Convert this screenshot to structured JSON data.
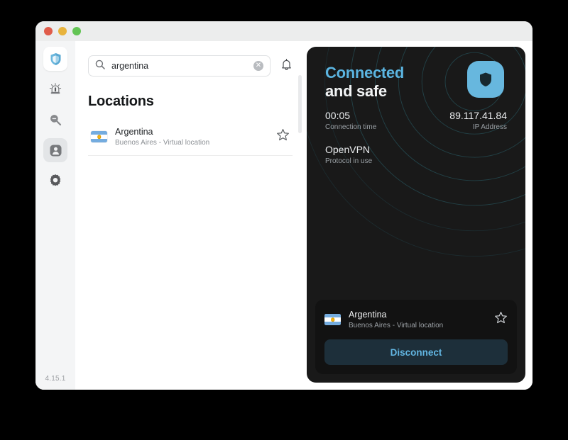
{
  "window": {
    "traffic_lights": [
      "close",
      "minimize",
      "maximize"
    ],
    "version": "4.15.1"
  },
  "sidebar": {
    "items": [
      {
        "icon": "shield-icon",
        "name": "vpn",
        "active": true
      },
      {
        "icon": "alarm-icon",
        "name": "threat",
        "active": false
      },
      {
        "icon": "search-scan-icon",
        "name": "scan",
        "active": false
      },
      {
        "icon": "account-icon",
        "name": "account",
        "active": false
      },
      {
        "icon": "gear-icon",
        "name": "settings",
        "active": false
      }
    ]
  },
  "search": {
    "value": "argentina",
    "placeholder": "Search",
    "icon": "search-icon",
    "clear_label": "✕",
    "notification_icon": "bell-icon"
  },
  "locations": {
    "title": "Locations",
    "items": [
      {
        "country": "Argentina",
        "subtitle": "Buenos Aires - Virtual location",
        "flag": "argentina-flag",
        "favorite": false
      }
    ]
  },
  "connection": {
    "status_line1": "Connected",
    "status_line2": "and safe",
    "time_value": "00:05",
    "time_label": "Connection time",
    "ip_value": "89.117.41.84",
    "ip_label": "IP Address",
    "protocol_value": "OpenVPN",
    "protocol_label": "Protocol in use",
    "logo_icon": "shield-logo-icon"
  },
  "active_location": {
    "country": "Argentina",
    "subtitle": "Buenos Aires - Virtual location",
    "flag": "argentina-flag",
    "favorite": false
  },
  "actions": {
    "disconnect_label": "Disconnect"
  },
  "colors": {
    "accent_blue": "#5bb4e0",
    "panel_dark": "#191919",
    "card_dark": "#121212",
    "button_dark": "#1d2f3a",
    "sidebar_bg": "#f4f5f6"
  }
}
